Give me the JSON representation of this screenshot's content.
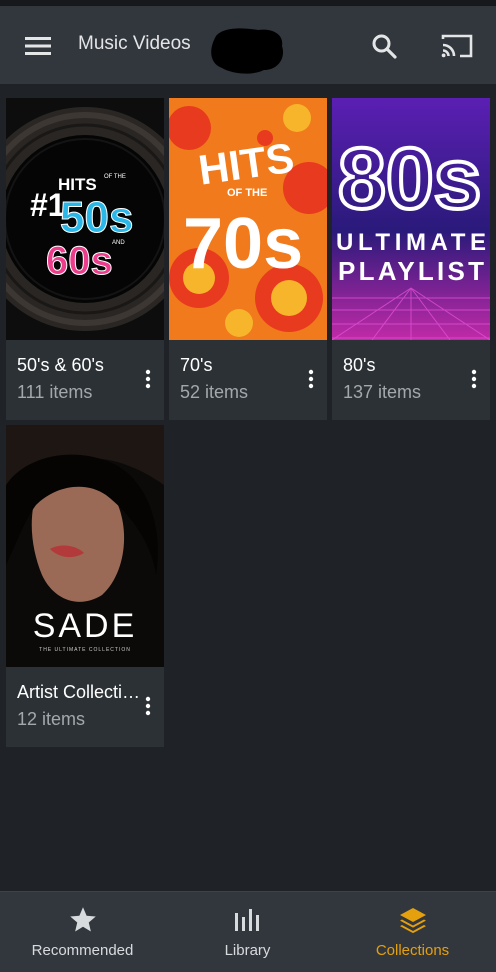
{
  "header": {
    "title": "Music Videos",
    "menu_icon": "hamburger-menu-icon",
    "search_icon": "search-icon",
    "cast_icon": "cast-icon"
  },
  "collections": [
    {
      "name": "50's & 60's",
      "count": "111 items",
      "art_text": [
        "#1",
        "HITS",
        "OF THE",
        "50s",
        "AND",
        "60s"
      ]
    },
    {
      "name": "70's",
      "count": "52 items",
      "art_text": [
        "HITS",
        "OF THE",
        "70s"
      ]
    },
    {
      "name": "80's",
      "count": "137 items",
      "art_text": [
        "80s",
        "ULTIMATE",
        "PLAYLIST"
      ]
    },
    {
      "name": "Artist Collecti…",
      "count": "12 items",
      "art_text": [
        "SADE",
        "THE ULTIMATE COLLECTION"
      ]
    }
  ],
  "bottom_nav": {
    "items": [
      {
        "label": "Recommended",
        "icon": "star-icon"
      },
      {
        "label": "Library",
        "icon": "library-bars-icon"
      },
      {
        "label": "Collections",
        "icon": "stack-layers-icon"
      }
    ],
    "active": "Collections"
  },
  "colors": {
    "background": "#1f2226",
    "appbar": "#32373d",
    "card": "#2c3136",
    "accent": "#e5a00d",
    "secondary_text": "#a3a8ad"
  }
}
